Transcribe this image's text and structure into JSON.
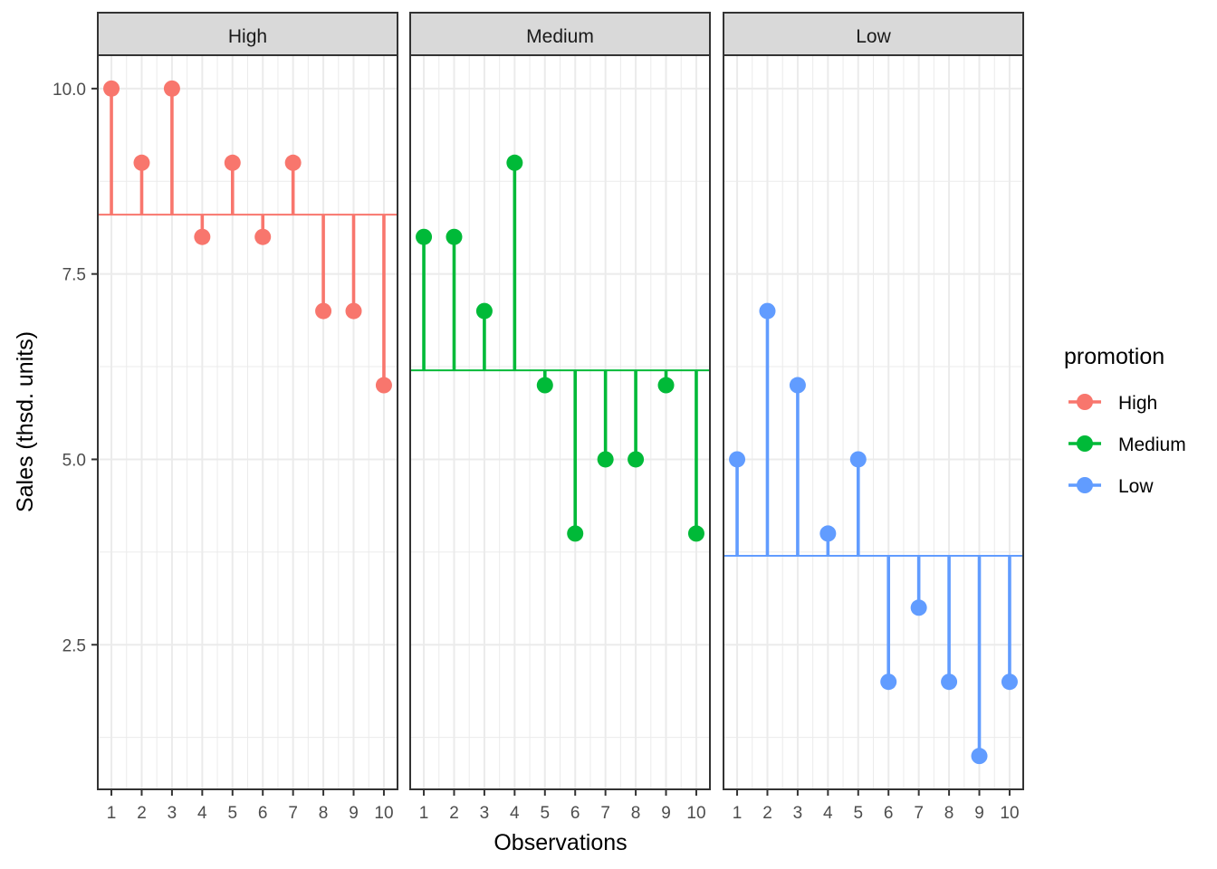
{
  "chart_data": {
    "type": "lollipop",
    "title": "",
    "xlabel": "Observations",
    "ylabel": "Sales (thsd. units)",
    "x": [
      1,
      2,
      3,
      4,
      5,
      6,
      7,
      8,
      9,
      10
    ],
    "x_tick_labels": [
      "1",
      "2",
      "3",
      "4",
      "5",
      "6",
      "7",
      "8",
      "9",
      "10"
    ],
    "xlim": [
      0.55,
      10.45
    ],
    "ylim": [
      0.55,
      10.45
    ],
    "y_ticks": [
      2.5,
      5.0,
      7.5,
      10.0
    ],
    "y_tick_labels": [
      "2.5",
      "5.0",
      "7.5",
      "10.0"
    ],
    "grid": true,
    "facets": [
      {
        "name": "High",
        "color": "#F8766D",
        "values": [
          10,
          9,
          10,
          8,
          9,
          8,
          9,
          7,
          7,
          6
        ],
        "mean": 8.3
      },
      {
        "name": "Medium",
        "color": "#00BA38",
        "values": [
          8,
          8,
          7,
          9,
          6,
          4,
          5,
          5,
          6,
          4
        ],
        "mean": 6.2
      },
      {
        "name": "Low",
        "color": "#619CFF",
        "values": [
          5,
          7,
          6,
          4,
          5,
          2,
          3,
          2,
          1,
          2
        ],
        "mean": 3.7
      }
    ],
    "legend": {
      "title": "promotion",
      "position": "right",
      "entries": [
        {
          "label": "High",
          "color": "#F8766D"
        },
        {
          "label": "Medium",
          "color": "#00BA38"
        },
        {
          "label": "Low",
          "color": "#619CFF"
        }
      ]
    }
  }
}
